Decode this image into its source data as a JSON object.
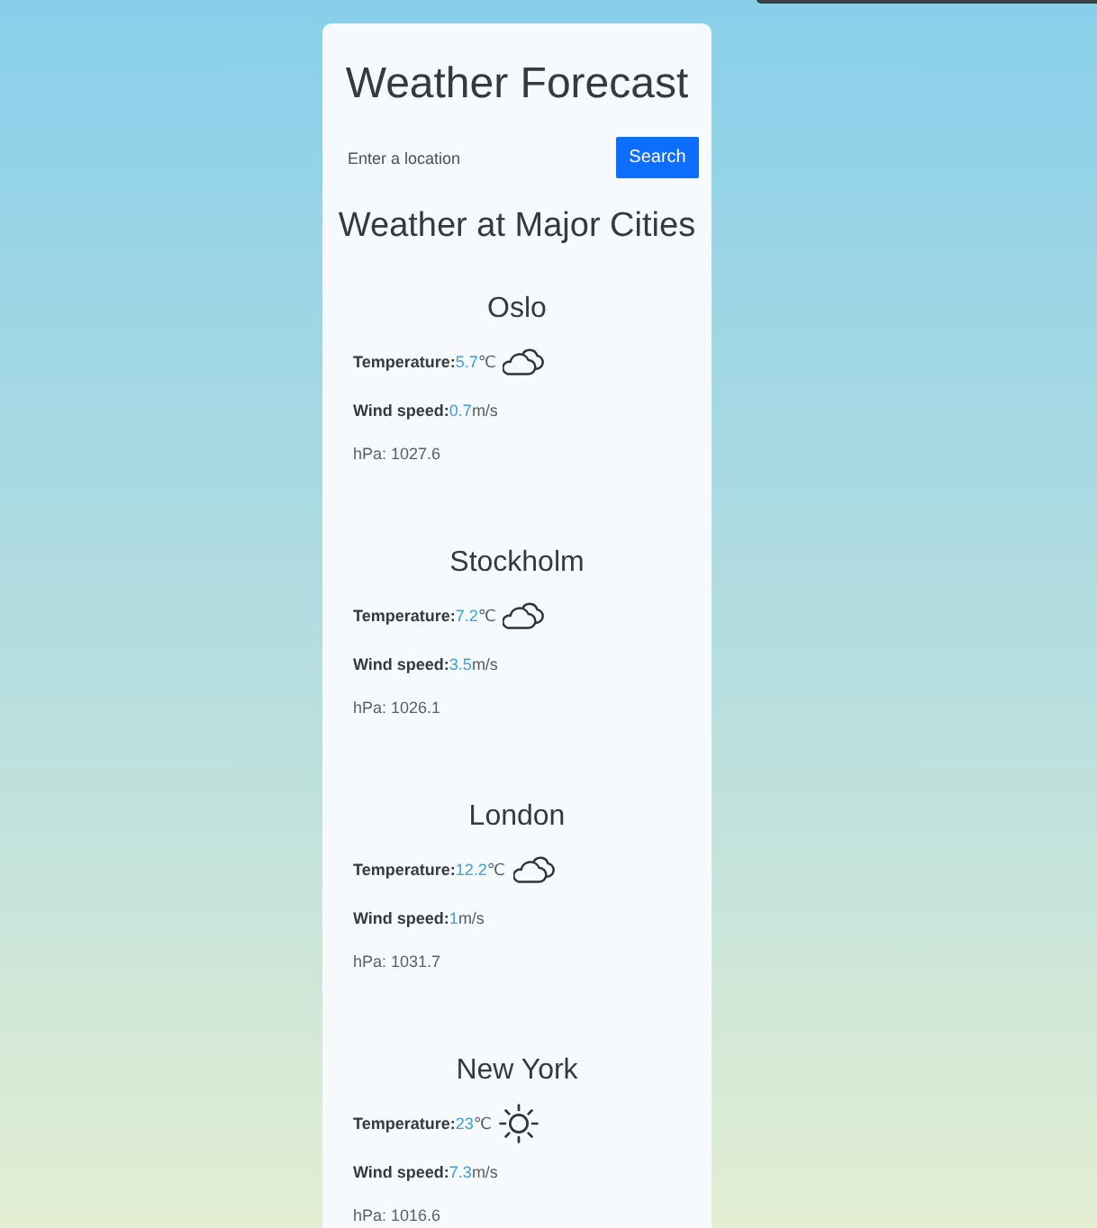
{
  "title": "Weather Forecast",
  "search": {
    "placeholder": "Enter a location",
    "button": "Search"
  },
  "section_title": "Weather at Major Cities",
  "cities": [
    {
      "name": "Oslo",
      "kind": "cloudy",
      "temperature_label": "Temperature:",
      "temperature": "5.7",
      "temperature_unit": "℃",
      "wind_label": "Wind speed:",
      "wind_speed": "0.7",
      "wind_unit": "m/s",
      "pressure": "hPa: 1027.6"
    },
    {
      "name": "Stockholm",
      "kind": "cloudy",
      "temperature_label": "Temperature:",
      "temperature": "7.2",
      "temperature_unit": "℃",
      "wind_label": "Wind speed:",
      "wind_speed": "3.5",
      "wind_unit": "m/s",
      "pressure": "hPa: 1026.1"
    },
    {
      "name": "London",
      "kind": "cloudy",
      "temperature_label": "Temperature:",
      "temperature": "12.2",
      "temperature_unit": "℃",
      "wind_label": "Wind speed:",
      "wind_speed": "1",
      "wind_unit": "m/s",
      "pressure": "hPa: 1031.7"
    },
    {
      "name": "New York",
      "kind": "sunny",
      "temperature_label": "Temperature:",
      "temperature": "23",
      "temperature_unit": "℃",
      "wind_label": "Wind speed:",
      "wind_speed": "7.3",
      "wind_unit": "m/s",
      "pressure": "hPa: 1016.6"
    }
  ]
}
